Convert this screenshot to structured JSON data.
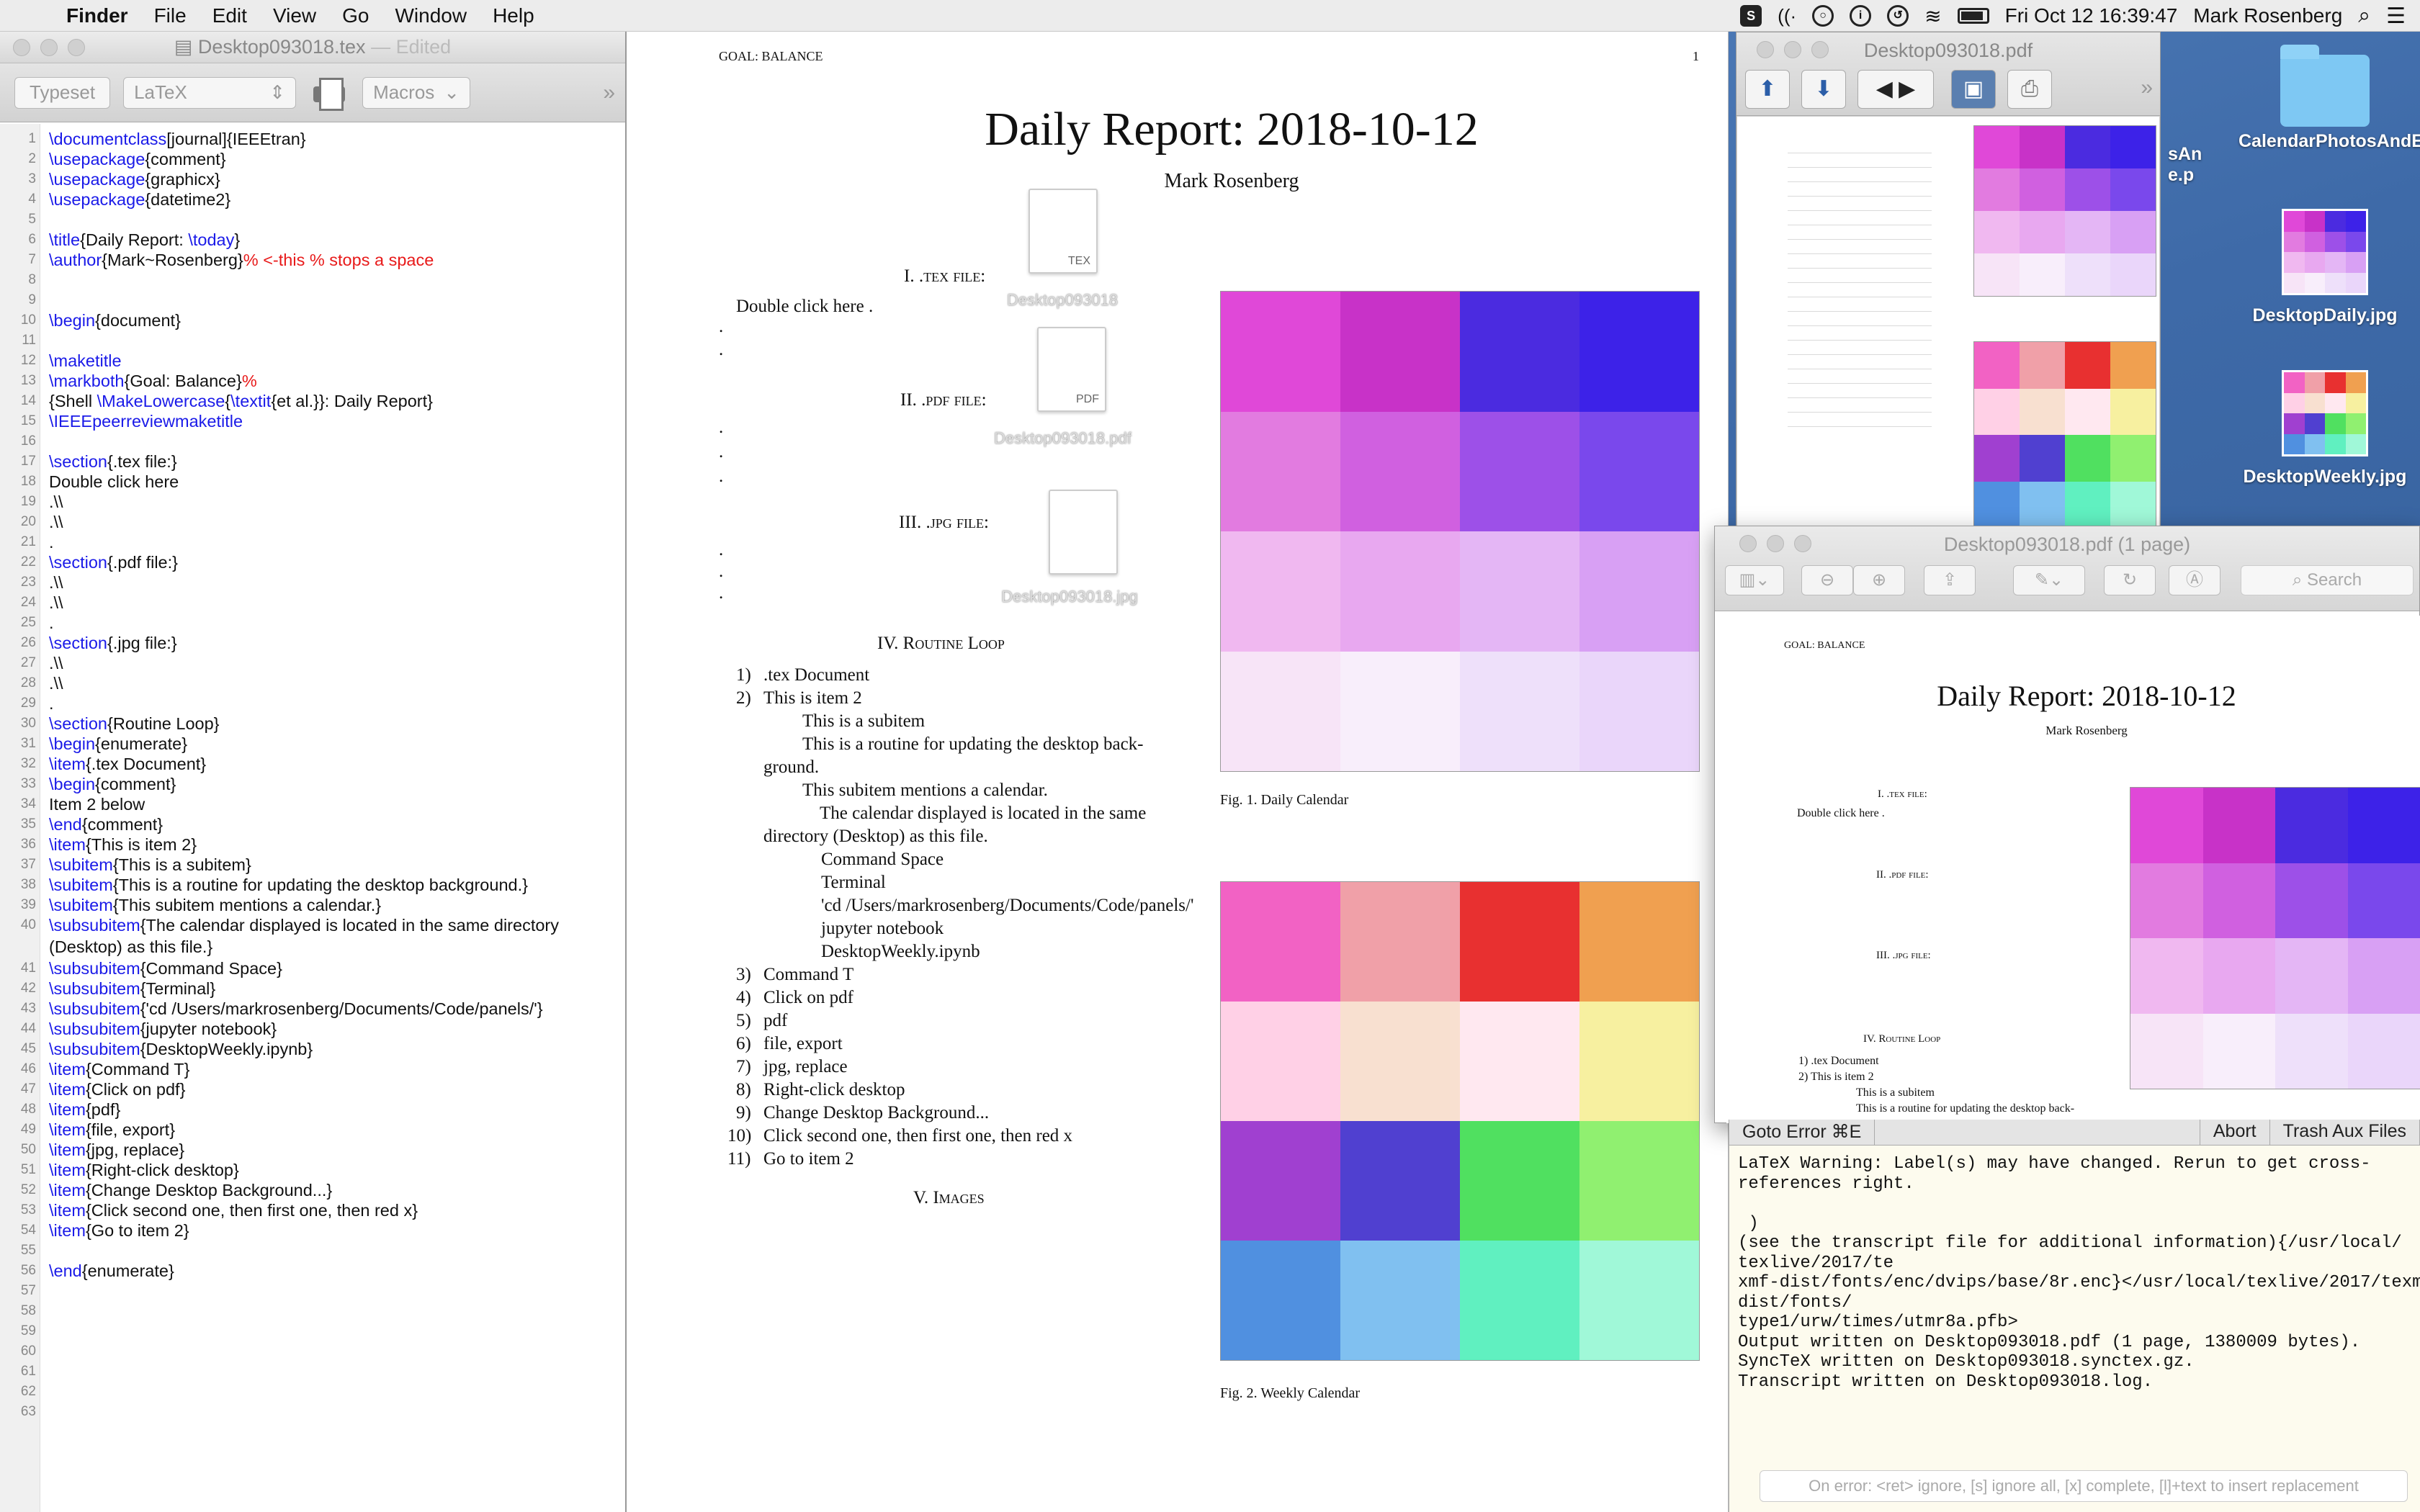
{
  "menubar": {
    "app": "Finder",
    "items": [
      "File",
      "Edit",
      "View",
      "Go",
      "Window",
      "Help"
    ],
    "clock": "Fri Oct 12  16:39:47",
    "user": "Mark Rosenberg"
  },
  "editor": {
    "title": "Desktop093018.tex",
    "edited": "— Edited",
    "typeset": "Typeset",
    "engine": "LaTeX",
    "macros": "Macros",
    "lines": [
      {
        "n": "1",
        "segs": [
          [
            "c",
            "\\documentclass"
          ],
          [
            "t",
            "[journal]{IEEEtran}"
          ]
        ]
      },
      {
        "n": "2",
        "segs": [
          [
            "c",
            "\\usepackage"
          ],
          [
            "t",
            "{comment}"
          ]
        ]
      },
      {
        "n": "3",
        "segs": [
          [
            "c",
            "\\usepackage"
          ],
          [
            "t",
            "{graphicx}"
          ]
        ]
      },
      {
        "n": "4",
        "segs": [
          [
            "c",
            "\\usepackage"
          ],
          [
            "t",
            "{datetime2}"
          ]
        ]
      },
      {
        "n": "5",
        "segs": []
      },
      {
        "n": "6",
        "segs": [
          [
            "c",
            "\\title"
          ],
          [
            "t",
            "{Daily Report: "
          ],
          [
            "c",
            "\\today"
          ],
          [
            "t",
            "}"
          ]
        ]
      },
      {
        "n": "7",
        "segs": [
          [
            "c",
            "\\author"
          ],
          [
            "t",
            "{Mark~Rosenberg}"
          ],
          [
            "m",
            "% <-this % stops a space"
          ]
        ]
      },
      {
        "n": "8",
        "segs": []
      },
      {
        "n": "9",
        "segs": []
      },
      {
        "n": "10",
        "segs": [
          [
            "c",
            "\\begin"
          ],
          [
            "t",
            "{document}"
          ]
        ]
      },
      {
        "n": "11",
        "segs": []
      },
      {
        "n": "12",
        "segs": [
          [
            "c",
            "\\maketitle"
          ]
        ]
      },
      {
        "n": "13",
        "segs": [
          [
            "c",
            "\\markboth"
          ],
          [
            "t",
            "{Goal: Balance}"
          ],
          [
            "m",
            "%"
          ]
        ]
      },
      {
        "n": "14",
        "segs": [
          [
            "t",
            "{Shell "
          ],
          [
            "c",
            "\\MakeLowercase"
          ],
          [
            "t",
            "{"
          ],
          [
            "c",
            "\\textit"
          ],
          [
            "t",
            "{et al.}}: Daily Report}"
          ]
        ]
      },
      {
        "n": "15",
        "segs": [
          [
            "c",
            "\\IEEEpeerreviewmaketitle"
          ]
        ]
      },
      {
        "n": "16",
        "segs": []
      },
      {
        "n": "17",
        "segs": [
          [
            "c",
            "\\section"
          ],
          [
            "t",
            "{.tex file:}"
          ]
        ]
      },
      {
        "n": "18",
        "segs": [
          [
            "t",
            "Double click here"
          ]
        ]
      },
      {
        "n": "19",
        "segs": [
          [
            "t",
            ".\\\\"
          ]
        ]
      },
      {
        "n": "20",
        "segs": [
          [
            "t",
            ".\\\\"
          ]
        ]
      },
      {
        "n": "21",
        "segs": [
          [
            "t",
            "."
          ]
        ]
      },
      {
        "n": "22",
        "segs": [
          [
            "c",
            "\\section"
          ],
          [
            "t",
            "{.pdf file:}"
          ]
        ]
      },
      {
        "n": "23",
        "segs": [
          [
            "t",
            ".\\\\"
          ]
        ]
      },
      {
        "n": "24",
        "segs": [
          [
            "t",
            ".\\\\"
          ]
        ]
      },
      {
        "n": "25",
        "segs": [
          [
            "t",
            "."
          ]
        ]
      },
      {
        "n": "26",
        "segs": [
          [
            "c",
            "\\section"
          ],
          [
            "t",
            "{.jpg file:}"
          ]
        ]
      },
      {
        "n": "27",
        "segs": [
          [
            "t",
            ".\\\\"
          ]
        ]
      },
      {
        "n": "28",
        "segs": [
          [
            "t",
            ".\\\\"
          ]
        ]
      },
      {
        "n": "29",
        "segs": [
          [
            "t",
            "."
          ]
        ]
      },
      {
        "n": "30",
        "segs": [
          [
            "c",
            "\\section"
          ],
          [
            "t",
            "{Routine Loop}"
          ]
        ]
      },
      {
        "n": "31",
        "segs": [
          [
            "c",
            "\\begin"
          ],
          [
            "t",
            "{enumerate}"
          ]
        ]
      },
      {
        "n": "32",
        "segs": [
          [
            "c",
            "\\item"
          ],
          [
            "t",
            "{.tex Document}"
          ]
        ]
      },
      {
        "n": "33",
        "segs": [
          [
            "c",
            "\\begin"
          ],
          [
            "t",
            "{comment}"
          ]
        ]
      },
      {
        "n": "34",
        "segs": [
          [
            "t",
            "Item 2 below"
          ]
        ]
      },
      {
        "n": "35",
        "segs": [
          [
            "c",
            "\\end"
          ],
          [
            "t",
            "{comment}"
          ]
        ]
      },
      {
        "n": "36",
        "segs": [
          [
            "c",
            "\\item"
          ],
          [
            "t",
            "{This is item 2}"
          ]
        ]
      },
      {
        "n": "37",
        "segs": [
          [
            "c",
            "\\subitem"
          ],
          [
            "t",
            "{This is a subitem}"
          ]
        ]
      },
      {
        "n": "38",
        "segs": [
          [
            "c",
            "\\subitem"
          ],
          [
            "t",
            "{This is a routine for updating the desktop background.}"
          ]
        ]
      },
      {
        "n": "39",
        "segs": [
          [
            "c",
            "\\subitem"
          ],
          [
            "t",
            "{This subitem mentions a calendar.}"
          ]
        ]
      },
      {
        "n": "40",
        "segs": [
          [
            "c",
            "\\subsubitem"
          ],
          [
            "t",
            "{The calendar displayed is located in the same directory (Desktop) as this file.}"
          ]
        ]
      },
      {
        "n": "41",
        "segs": [
          [
            "c",
            "\\subsubitem"
          ],
          [
            "t",
            "{Command Space}"
          ]
        ]
      },
      {
        "n": "42",
        "segs": [
          [
            "c",
            "\\subsubitem"
          ],
          [
            "t",
            "{Terminal}"
          ]
        ]
      },
      {
        "n": "43",
        "segs": [
          [
            "c",
            "\\subsubitem"
          ],
          [
            "t",
            "{'cd /Users/markrosenberg/Documents/Code/panels/'}"
          ]
        ]
      },
      {
        "n": "44",
        "segs": [
          [
            "c",
            "\\subsubitem"
          ],
          [
            "t",
            "{jupyter notebook}"
          ]
        ]
      },
      {
        "n": "45",
        "segs": [
          [
            "c",
            "\\subsubitem"
          ],
          [
            "t",
            "{DesktopWeekly.ipynb}"
          ]
        ]
      },
      {
        "n": "46",
        "segs": [
          [
            "c",
            "\\item"
          ],
          [
            "t",
            "{Command T}"
          ]
        ]
      },
      {
        "n": "47",
        "segs": [
          [
            "c",
            "\\item"
          ],
          [
            "t",
            "{Click on pdf}"
          ]
        ]
      },
      {
        "n": "48",
        "segs": [
          [
            "c",
            "\\item"
          ],
          [
            "t",
            "{pdf}"
          ]
        ]
      },
      {
        "n": "49",
        "segs": [
          [
            "c",
            "\\item"
          ],
          [
            "t",
            "{file, export}"
          ]
        ]
      },
      {
        "n": "50",
        "segs": [
          [
            "c",
            "\\item"
          ],
          [
            "t",
            "{jpg, replace}"
          ]
        ]
      },
      {
        "n": "51",
        "segs": [
          [
            "c",
            "\\item"
          ],
          [
            "t",
            "{Right-click desktop}"
          ]
        ]
      },
      {
        "n": "52",
        "segs": [
          [
            "c",
            "\\item"
          ],
          [
            "t",
            "{Change Desktop Background...}"
          ]
        ]
      },
      {
        "n": "53",
        "segs": [
          [
            "c",
            "\\item"
          ],
          [
            "t",
            "{Click second one, then first one, then red x}"
          ]
        ]
      },
      {
        "n": "54",
        "segs": [
          [
            "c",
            "\\item"
          ],
          [
            "t",
            "{Go to item 2}"
          ]
        ]
      },
      {
        "n": "55",
        "segs": []
      },
      {
        "n": "56",
        "segs": [
          [
            "c",
            "\\end"
          ],
          [
            "t",
            "{enumerate}"
          ]
        ]
      },
      {
        "n": "57",
        "segs": []
      },
      {
        "n": "58",
        "segs": []
      },
      {
        "n": "59",
        "segs": []
      },
      {
        "n": "60",
        "segs": []
      },
      {
        "n": "61",
        "segs": []
      },
      {
        "n": "62",
        "segs": []
      },
      {
        "n": "63",
        "segs": []
      }
    ]
  },
  "pdf": {
    "header_left": "GOAL: BALANCE",
    "page_num": "1",
    "title": "Daily Report: 2018-10-12",
    "author": "Mark Rosenberg",
    "sec1": "I.   .tex file:",
    "sec2": "II.   .pdf file:",
    "sec3": "III.   .jpg file:",
    "sec4": "IV.   Routine Loop",
    "sec5": "V.   Images",
    "double_click": "Double click here .",
    "fig1_cap": "Fig. 1.   Daily Calendar",
    "fig2_cap": "Fig. 2.   Weekly Calendar",
    "tex_icon_label": "TEX",
    "pdf_icon_label": "PDF",
    "tex_file_label": "Desktop093018",
    "pdf_file_label": "Desktop093018.pdf",
    "jpg_file_label": "Desktop093018.jpg",
    "list": [
      {
        "num": "1)",
        "text": ".tex Document",
        "lvl": 0
      },
      {
        "num": "2)",
        "text": "This is item 2",
        "lvl": 0
      },
      {
        "num": "",
        "text": "This is a subitem",
        "lvl": 1
      },
      {
        "num": "",
        "text": "This is a routine for updating the desktop back-",
        "lvl": 1
      },
      {
        "num": "",
        "text": "ground.",
        "lvl": -1
      },
      {
        "num": "",
        "text": "This subitem mentions a calendar.",
        "lvl": 1
      },
      {
        "num": "",
        "text": "The calendar displayed is located in the same",
        "lvl": 2
      },
      {
        "num": "",
        "text": "directory (Desktop) as this file.",
        "lvl": -1
      },
      {
        "num": "",
        "text": "Command Space",
        "lvl": 3
      },
      {
        "num": "",
        "text": "Terminal",
        "lvl": 3
      },
      {
        "num": "",
        "text": "'cd /Users/markrosenberg/Documents/Code/panels/'",
        "lvl": 3
      },
      {
        "num": "",
        "text": "jupyter notebook",
        "lvl": 3
      },
      {
        "num": "",
        "text": "DesktopWeekly.ipynb",
        "lvl": 3
      },
      {
        "num": "3)",
        "text": "Command T",
        "lvl": 0
      },
      {
        "num": "4)",
        "text": "Click on pdf",
        "lvl": 0
      },
      {
        "num": "5)",
        "text": "pdf",
        "lvl": 0
      },
      {
        "num": "6)",
        "text": "file, export",
        "lvl": 0
      },
      {
        "num": "7)",
        "text": "jpg, replace",
        "lvl": 0
      },
      {
        "num": "8)",
        "text": "Right-click desktop",
        "lvl": 0
      },
      {
        "num": "9)",
        "text": "Change Desktop Background...",
        "lvl": 0
      },
      {
        "num": "10)",
        "text": "Click second one, then first one, then red x",
        "lvl": 0
      },
      {
        "num": "11)",
        "text": "Go to item 2",
        "lvl": 0
      }
    ]
  },
  "viewer": {
    "title": "Desktop093018.pdf"
  },
  "preview": {
    "title": "Desktop093018.pdf (1 page)",
    "search_placeholder": "Search",
    "header_left": "GOAL: BALANCE",
    "title_text": "Daily Report: 2018-10-12",
    "author": "Mark Rosenberg",
    "sec1": "I.   .tex file:",
    "sec2": "II.   .pdf file:",
    "sec3": "III.   .jpg file:",
    "sec4": "IV.   Routine Loop",
    "double_click": "Double click here .",
    "items": [
      "1)  .tex Document",
      "2)  This is item 2",
      "This is a subitem",
      "This is a routine for updating the desktop back-"
    ]
  },
  "console": {
    "goto_error": "Goto Error  ⌘E",
    "abort": "Abort",
    "trash": "Trash Aux Files",
    "log": "LaTeX Warning: Label(s) may have changed. Rerun to get cross-\nreferences right.\n\n )\n(see the transcript file for additional information){/usr/local/\ntexlive/2017/te\nxmf-dist/fonts/enc/dvips/base/8r.enc}</usr/local/texlive/2017/texm\ndist/fonts/\ntype1/urw/times/utmr8a.pfb>\nOutput written on Desktop093018.pdf (1 page, 1380009 bytes).\nSyncTeX written on Desktop093018.synctex.gz.\nTranscript written on Desktop093018.log.",
    "input_placeholder": "On error: <ret> ignore, [s] ignore all, [x] complete, [l]+text to insert replacement"
  },
  "desktop": {
    "icons": [
      "CalendarPhotosAndEvents",
      "DesktopDaily.jpg",
      "DesktopWeekly.jpg"
    ],
    "partial_label": "sAn e.p"
  },
  "colors": {
    "latex_command": "#1a1ae8",
    "latex_comment": "#e81a1a",
    "daily_calendar": [
      "#e048d8",
      "#c832c8",
      "#4b2be0",
      "#3d22e8",
      "#e27be0",
      "#d060e0",
      "#9d50e8",
      "#7a48ec",
      "#f0b8f0",
      "#e8a8f0",
      "#e4b6f5",
      "#d8a0f4",
      "#f7e4f7",
      "#f8eefb",
      "#eee0fa",
      "#ead6fa"
    ],
    "weekly_calendar": [
      "#f262c4",
      "#f0a0a8",
      "#e83030",
      "#f0a050",
      "#ffd0e6",
      "#f8e0d0",
      "#ffe8f0",
      "#f7f0a0",
      "#a040d0",
      "#5040d0",
      "#50e060",
      "#90f070",
      "#5090e0",
      "#80c0f0",
      "#60f0c0",
      "#a0f8d8"
    ]
  }
}
